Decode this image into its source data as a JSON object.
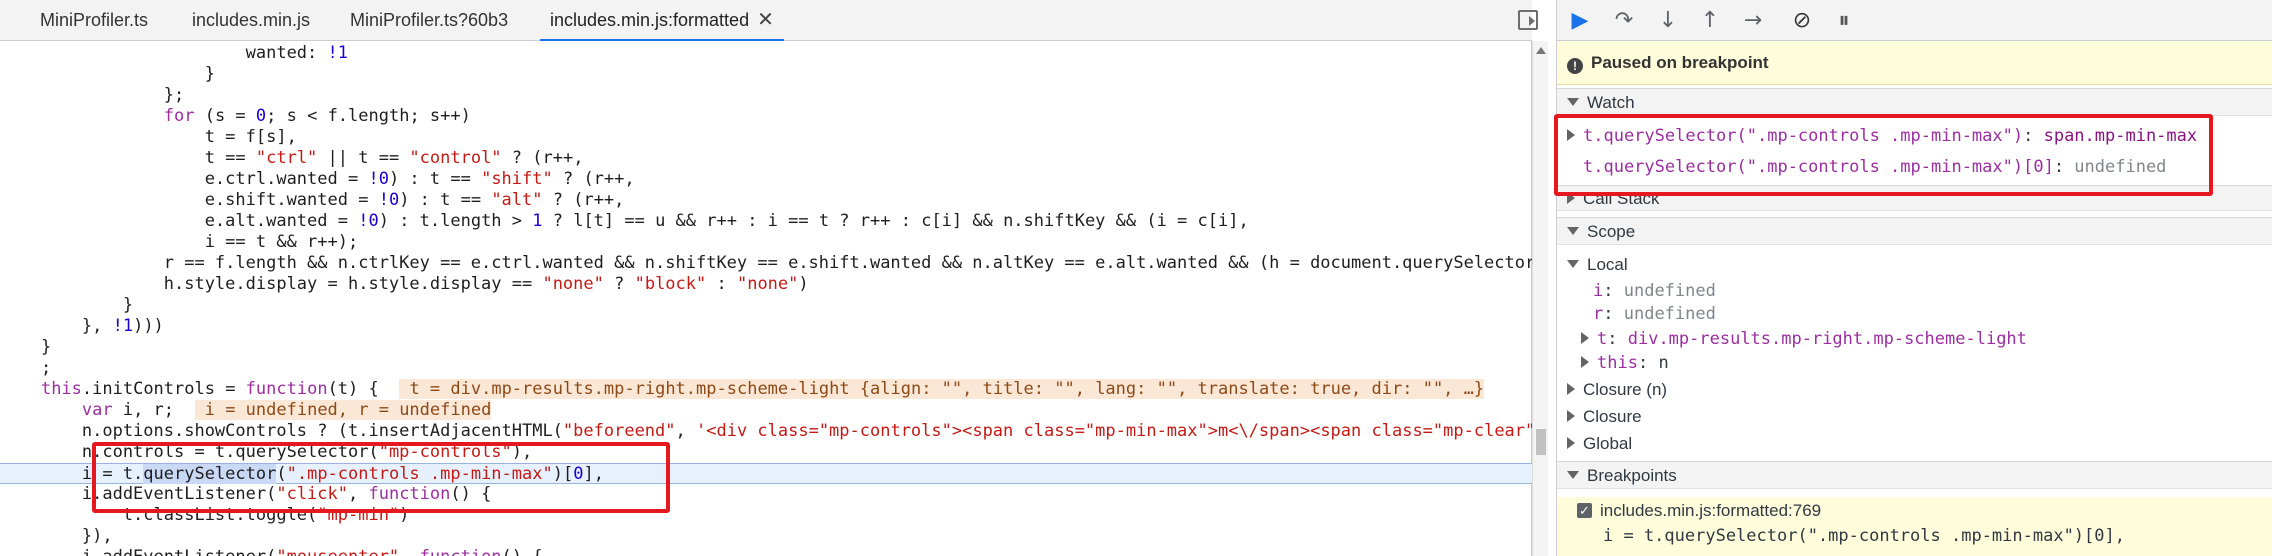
{
  "tabs": [
    {
      "label": "MiniProfiler.ts",
      "active": false
    },
    {
      "label": "includes.min.js",
      "active": false
    },
    {
      "label": "MiniProfiler.ts?60b3",
      "active": false
    },
    {
      "label": "includes.min.js:formatted",
      "active": true,
      "closable": true
    }
  ],
  "code_lines": [
    {
      "parts": [
        {
          "t": "                        wanted: "
        },
        {
          "t": "!1",
          "c": "num"
        }
      ]
    },
    {
      "parts": [
        {
          "t": "                    }"
        }
      ]
    },
    {
      "parts": [
        {
          "t": "                };"
        }
      ]
    },
    {
      "parts": [
        {
          "t": "                "
        },
        {
          "t": "for",
          "c": "kw"
        },
        {
          "t": " (s = "
        },
        {
          "t": "0",
          "c": "num"
        },
        {
          "t": "; s < f.length; s++)"
        }
      ]
    },
    {
      "parts": [
        {
          "t": "                    t = f[s],"
        }
      ]
    },
    {
      "parts": [
        {
          "t": "                    t == "
        },
        {
          "t": "\"ctrl\"",
          "c": "str"
        },
        {
          "t": " || t == "
        },
        {
          "t": "\"control\"",
          "c": "str"
        },
        {
          "t": " ? (r++,"
        }
      ]
    },
    {
      "parts": [
        {
          "t": "                    e.ctrl.wanted = "
        },
        {
          "t": "!0",
          "c": "num"
        },
        {
          "t": ") : t == "
        },
        {
          "t": "\"shift\"",
          "c": "str"
        },
        {
          "t": " ? (r++,"
        }
      ]
    },
    {
      "parts": [
        {
          "t": "                    e.shift.wanted = "
        },
        {
          "t": "!0",
          "c": "num"
        },
        {
          "t": ") : t == "
        },
        {
          "t": "\"alt\"",
          "c": "str"
        },
        {
          "t": " ? (r++,"
        }
      ]
    },
    {
      "parts": [
        {
          "t": "                    e.alt.wanted = "
        },
        {
          "t": "!0",
          "c": "num"
        },
        {
          "t": ") : t.length > "
        },
        {
          "t": "1",
          "c": "num"
        },
        {
          "t": " ? l[t] == u && r++ : i == t ? r++ : c[i] && n.shiftKey && (i = c[i],"
        }
      ]
    },
    {
      "parts": [
        {
          "t": "                    i == t && r++);"
        }
      ]
    },
    {
      "parts": [
        {
          "t": "                r == f.length && n.ctrlKey == e.ctrl.wanted && n.shiftKey == e.shift.wanted && n.altKey == e.alt.wanted && (h = document.querySelector"
        }
      ]
    },
    {
      "parts": [
        {
          "t": "                h.style.display = h.style.display == "
        },
        {
          "t": "\"none\"",
          "c": "str"
        },
        {
          "t": " ? "
        },
        {
          "t": "\"block\"",
          "c": "str"
        },
        {
          "t": " : "
        },
        {
          "t": "\"none\"",
          "c": "str"
        },
        {
          "t": ")"
        }
      ]
    },
    {
      "parts": [
        {
          "t": "            }"
        }
      ]
    },
    {
      "parts": [
        {
          "t": "        }, "
        },
        {
          "t": "!1",
          "c": "num"
        },
        {
          "t": ")))"
        }
      ]
    },
    {
      "parts": [
        {
          "t": "    }"
        }
      ]
    },
    {
      "parts": [
        {
          "t": "    ;"
        }
      ]
    },
    {
      "parts": [
        {
          "t": "    "
        },
        {
          "t": "this",
          "c": "kw"
        },
        {
          "t": ".initControls = "
        },
        {
          "t": "function",
          "c": "kw"
        },
        {
          "t": "(t) {  "
        },
        {
          "t": " t = div.mp-results.mp-right.mp-scheme-light {align: \"\", title: \"\", lang: \"\", translate: true, dir: \"\", …}",
          "c": "inl"
        }
      ]
    },
    {
      "parts": [
        {
          "t": "        "
        },
        {
          "t": "var",
          "c": "kw"
        },
        {
          "t": " i, r;  "
        },
        {
          "t": " i = undefined, r = undefined",
          "c": "inl"
        }
      ]
    },
    {
      "parts": [
        {
          "t": "        n.options.showControls ? (t.insertAdjacentHTML("
        },
        {
          "t": "\"beforeend\"",
          "c": "str"
        },
        {
          "t": ", "
        },
        {
          "t": "'<div class=\"mp-controls\"><span class=\"mp-min-max\">m<\\/span><span class=\"mp-clear\"",
          "c": "str"
        }
      ]
    },
    {
      "parts": [
        {
          "t": "        n.controls = t.querySelector("
        },
        {
          "t": "\"mp-controls\"",
          "c": "str"
        },
        {
          "t": "),"
        }
      ]
    },
    {
      "parts": [
        {
          "t": "        i = t."
        },
        {
          "t": "querySelector",
          "c": "sel"
        },
        {
          "t": "("
        },
        {
          "t": "\".mp-controls .mp-min-max\"",
          "c": "str"
        },
        {
          "t": ")["
        },
        {
          "t": "0",
          "c": "num"
        },
        {
          "t": "],"
        }
      ],
      "exec": true
    },
    {
      "parts": [
        {
          "t": "        i.addEventListener("
        },
        {
          "t": "\"click\"",
          "c": "str"
        },
        {
          "t": ", "
        },
        {
          "t": "function",
          "c": "kw"
        },
        {
          "t": "() {"
        }
      ]
    },
    {
      "parts": [
        {
          "t": "            t.classList.toggle("
        },
        {
          "t": "\"mp-min\"",
          "c": "str"
        },
        {
          "t": ")"
        }
      ]
    },
    {
      "parts": [
        {
          "t": "        }),"
        }
      ]
    },
    {
      "parts": [
        {
          "t": "        i.addEventListener("
        },
        {
          "t": "\"mouseenter\"",
          "c": "str"
        },
        {
          "t": ", "
        },
        {
          "t": "function",
          "c": "kw"
        },
        {
          "t": "() {"
        }
      ]
    }
  ],
  "toolbar": {
    "resume_icon": "resume-icon",
    "step_over_icon": "step-over-icon",
    "step_into_icon": "step-into-icon",
    "step_out_icon": "step-out-icon",
    "step_icon": "step-icon",
    "deactivate_icon": "deactivate-breakpoints-icon",
    "pause_exceptions_icon": "pause-on-exceptions-icon"
  },
  "paused_banner": {
    "label": "Paused on breakpoint"
  },
  "watch": {
    "title": "Watch",
    "items": [
      {
        "expr": "t.querySelector(\".mp-controls .mp-min-max\")",
        "value": "span.mp-min-max",
        "expandable": true
      },
      {
        "expr": "t.querySelector(\".mp-controls .mp-min-max\")[0]",
        "value": "undefined",
        "expandable": false
      }
    ]
  },
  "call_stack": {
    "title": "Call Stack"
  },
  "scope": {
    "title": "Scope",
    "local_label": "Local",
    "locals": [
      {
        "name": "i",
        "value": "undefined",
        "expandable": false
      },
      {
        "name": "r",
        "value": "undefined",
        "expandable": false
      },
      {
        "name": "t",
        "value": "div.mp-results.mp-right.mp-scheme-light",
        "expandable": true
      },
      {
        "name": "this",
        "value": "n",
        "expandable": true
      }
    ],
    "others": [
      "Closure (n)",
      "Closure",
      "Global"
    ]
  },
  "breakpoints": {
    "title": "Breakpoints",
    "items": [
      {
        "location": "includes.min.js:formatted:769",
        "code": "i = t.querySelector(\".mp-controls .mp-min-max\")[0],",
        "checked": true
      }
    ]
  },
  "colors": {
    "accent": "#1a73e8",
    "highlight_box": "#e4181e",
    "paused_bg": "#fffcdb"
  }
}
